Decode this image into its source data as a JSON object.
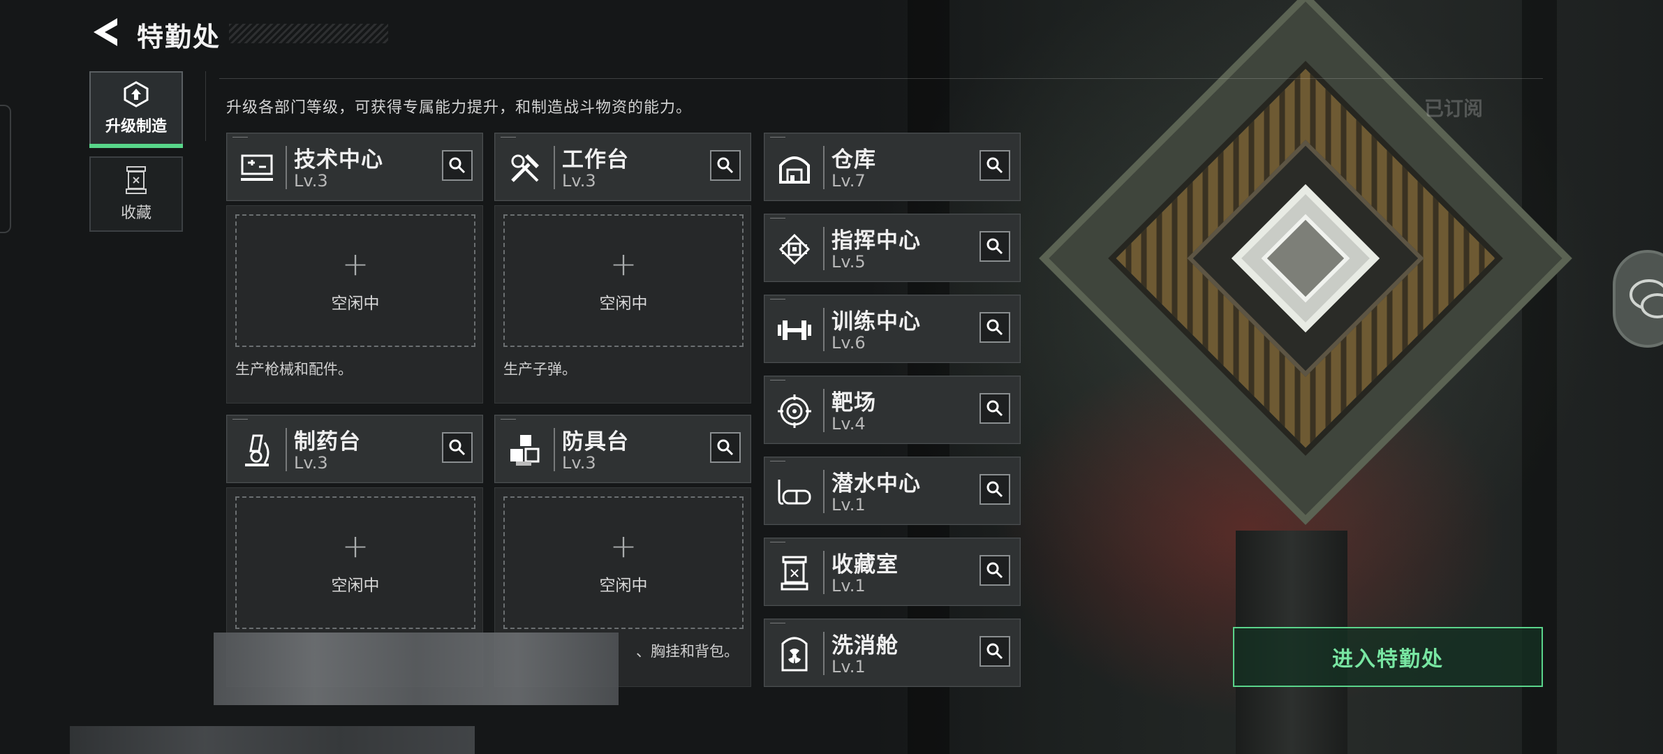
{
  "header": {
    "title": "特勤处"
  },
  "sidebar": {
    "tabs": [
      {
        "label": "升级制造",
        "icon": "upgrade-gear-icon",
        "active": true
      },
      {
        "label": "收藏",
        "icon": "collection-capsule-icon",
        "active": false
      }
    ]
  },
  "main": {
    "description": "升级各部门等级，可获得专属能力提升，和制造战斗物资的能力。",
    "subscribed_label": "已订阅",
    "workshops": [
      {
        "name": "技术中心",
        "level": "Lv.3",
        "icon": "tech-center-icon",
        "slot_status": "空闲中",
        "note": "生产枪械和配件。"
      },
      {
        "name": "工作台",
        "level": "Lv.3",
        "icon": "workbench-tools-icon",
        "slot_status": "空闲中",
        "note": "生产子弹。"
      },
      {
        "name": "制药台",
        "level": "Lv.3",
        "icon": "microscope-icon",
        "slot_status": "空闲中",
        "note": ""
      },
      {
        "name": "防具台",
        "level": "Lv.3",
        "icon": "armor-blocks-icon",
        "slot_status": "空闲中",
        "note": "、胸挂和背包。"
      }
    ],
    "facilities": [
      {
        "name": "仓库",
        "level": "Lv.7",
        "icon": "warehouse-icon"
      },
      {
        "name": "指挥中心",
        "level": "Lv.5",
        "icon": "command-chip-icon"
      },
      {
        "name": "训练中心",
        "level": "Lv.6",
        "icon": "dumbbell-icon"
      },
      {
        "name": "靶场",
        "level": "Lv.4",
        "icon": "target-icon"
      },
      {
        "name": "潜水中心",
        "level": "Lv.1",
        "icon": "diving-mask-icon"
      },
      {
        "name": "收藏室",
        "level": "Lv.1",
        "icon": "display-case-icon"
      },
      {
        "name": "洗消舱",
        "level": "Lv.1",
        "icon": "radiation-chamber-icon"
      }
    ],
    "enter_button": "进入特勤处"
  },
  "colors": {
    "accent": "#58d68a",
    "panel": "#2f3233",
    "background": "#151718"
  }
}
